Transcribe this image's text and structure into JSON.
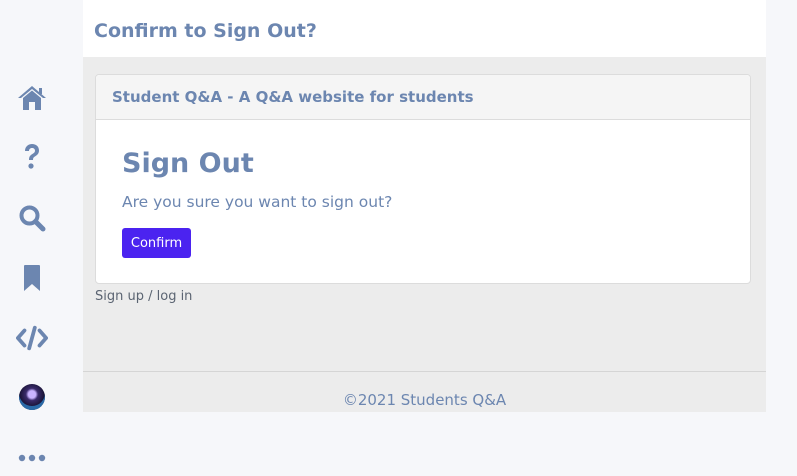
{
  "page": {
    "title": "Confirm to Sign Out?"
  },
  "sidebar": {
    "items": [
      {
        "icon": "home-icon"
      },
      {
        "icon": "question-icon"
      },
      {
        "icon": "search-icon"
      },
      {
        "icon": "bookmark-icon"
      },
      {
        "icon": "code-icon"
      },
      {
        "icon": "avatar"
      },
      {
        "icon": "more-icon"
      }
    ]
  },
  "card": {
    "header": "Student Q&A - A Q&A website for students",
    "heading": "Sign Out",
    "question": "Are you sure you want to sign out?",
    "confirm_label": "Confirm"
  },
  "links": {
    "signup": "Sign up / log in"
  },
  "footer": {
    "text": "©2021 Students Q&A"
  },
  "colors": {
    "accent": "#6c86b0",
    "button": "#4b23f0",
    "background": "#ececec"
  }
}
